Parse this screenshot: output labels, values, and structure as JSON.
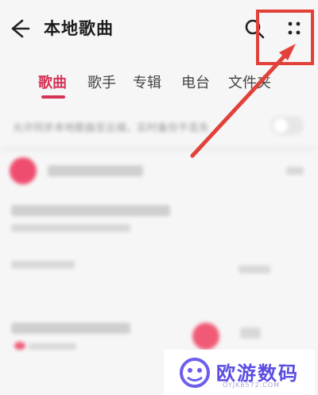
{
  "header": {
    "title": "本地歌曲",
    "back_icon": "arrow-left-icon",
    "search_icon": "search-icon",
    "more_icon": "more-grid-icon"
  },
  "tabs": [
    {
      "label": "歌曲",
      "active": true
    },
    {
      "label": "歌手",
      "active": false
    },
    {
      "label": "专辑",
      "active": false
    },
    {
      "label": "电台",
      "active": false
    },
    {
      "label": "文件夹",
      "active": false
    }
  ],
  "content": {
    "sync_text": "允许同步本地歌曲至云端，实时备份不丢失"
  },
  "watermark": {
    "name": "欧游数码",
    "url": "OYJK6572.COM"
  },
  "colors": {
    "accent": "#d53456",
    "annotation": "#e2413a",
    "watermark": "#5a4de0"
  }
}
